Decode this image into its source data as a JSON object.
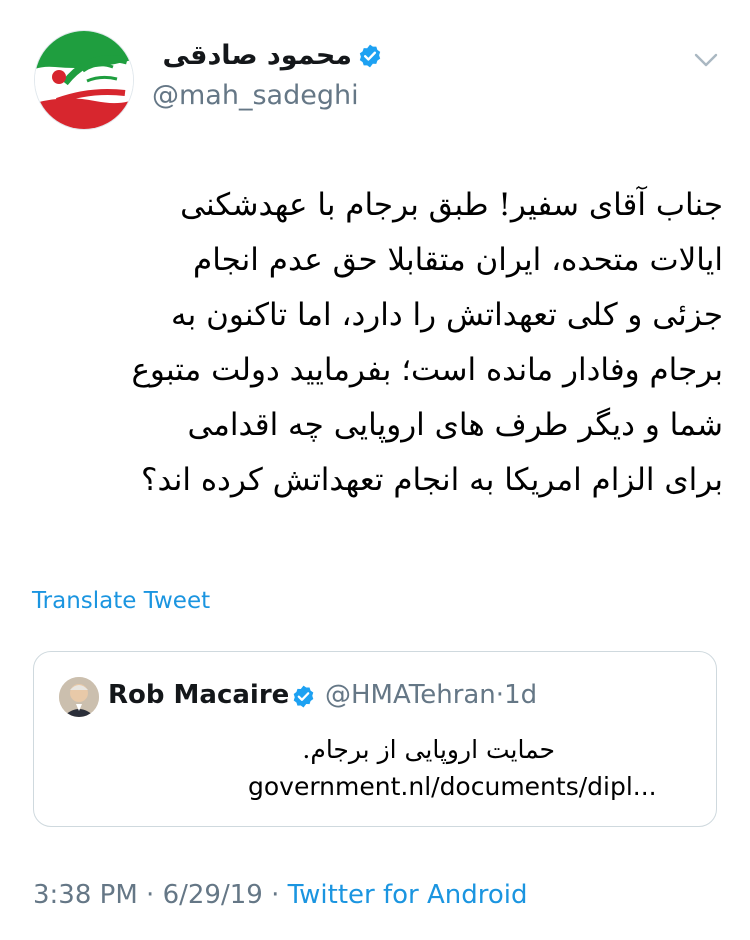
{
  "author": {
    "display_name": "محمود صادقی",
    "handle": "@mah_sadeghi",
    "verified": true
  },
  "tweet": {
    "lines": [
      "جناب آقای سفیر! طبق برجام با عهدشکنی",
      "ایالات متحده، ایران متقابلا حق عدم انجام",
      "جزئی و کلی تعهداتش را دارد، اما تاکنون به",
      "برجام وفادار مانده است؛  بفرمایید دولت متبوع",
      "شما و دیگر طرف های اروپایی چه اقدامی",
      "برای الزام امریکا به انجام تعهداتش کرده اند؟"
    ],
    "translate_label": "Translate Tweet"
  },
  "quoted": {
    "name": "Rob Macaire",
    "handle": "@HMATehran",
    "sep": "·",
    "time": "1d",
    "text_line1": "حمایت اروپایی از برجام.",
    "text_line2": "government.nl/documents/dipl..."
  },
  "footer": {
    "time": "3:38 PM",
    "sep1": "·",
    "date": "6/29/19",
    "sep2": "·",
    "source": "Twitter for Android"
  },
  "colors": {
    "link": "#1b95e0",
    "secondary_text": "#657786",
    "verified_badge": "#1da1f2",
    "border": "#cfd9de"
  },
  "icons": {
    "verified": "verified-badge-icon",
    "more": "chevron-down-icon"
  }
}
